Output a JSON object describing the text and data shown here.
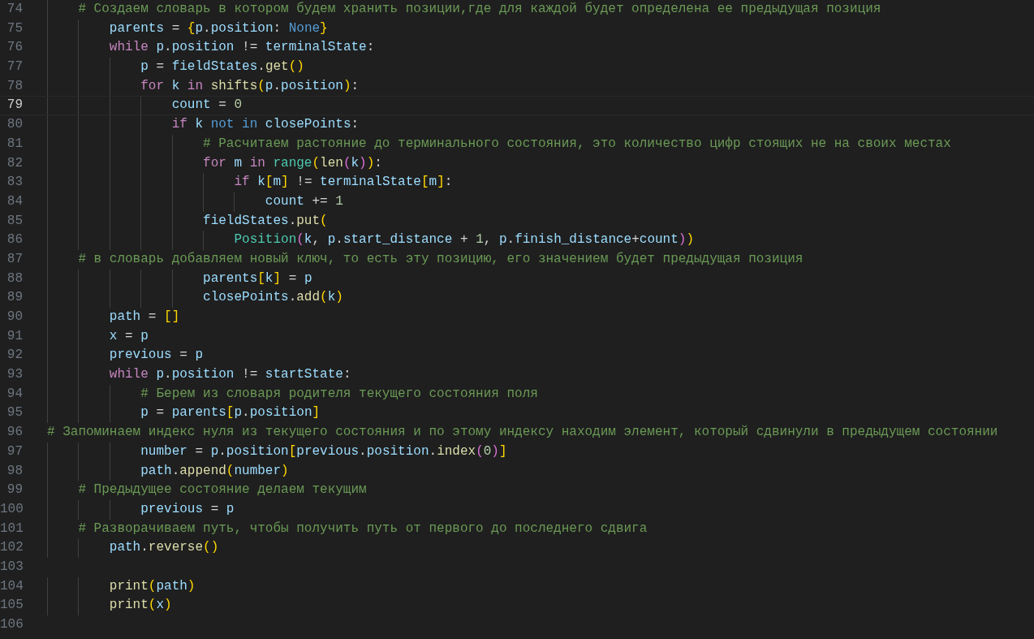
{
  "editor": {
    "lines": [
      {
        "number": "74",
        "current": false,
        "tokens": [
          {
            "kind": "cmt",
            "text": "    # Создаем словарь в котором будем хранить позиции,где для каждой будет определена ее предыдущая позиция"
          }
        ]
      },
      {
        "number": "75",
        "current": false,
        "tokens": [
          {
            "kind": "var",
            "text": "        parents"
          },
          {
            "kind": "op",
            "text": " = "
          },
          {
            "kind": "b1",
            "text": "{"
          },
          {
            "kind": "var",
            "text": "p"
          },
          {
            "kind": "op",
            "text": "."
          },
          {
            "kind": "var",
            "text": "position"
          },
          {
            "kind": "op",
            "text": ": "
          },
          {
            "kind": "const",
            "text": "None"
          },
          {
            "kind": "b1",
            "text": "}"
          }
        ]
      },
      {
        "number": "76",
        "current": false,
        "tokens": [
          {
            "kind": "kw",
            "text": "        while "
          },
          {
            "kind": "var",
            "text": "p"
          },
          {
            "kind": "op",
            "text": "."
          },
          {
            "kind": "var",
            "text": "position"
          },
          {
            "kind": "op",
            "text": " != "
          },
          {
            "kind": "var",
            "text": "terminalState"
          },
          {
            "kind": "op",
            "text": ":"
          }
        ]
      },
      {
        "number": "77",
        "current": false,
        "tokens": [
          {
            "kind": "var",
            "text": "            p"
          },
          {
            "kind": "op",
            "text": " = "
          },
          {
            "kind": "var",
            "text": "fieldStates"
          },
          {
            "kind": "op",
            "text": "."
          },
          {
            "kind": "fn",
            "text": "get"
          },
          {
            "kind": "b1",
            "text": "()"
          }
        ]
      },
      {
        "number": "78",
        "current": false,
        "tokens": [
          {
            "kind": "kw",
            "text": "            for "
          },
          {
            "kind": "var",
            "text": "k "
          },
          {
            "kind": "kw",
            "text": "in "
          },
          {
            "kind": "fn",
            "text": "shifts"
          },
          {
            "kind": "b1",
            "text": "("
          },
          {
            "kind": "var",
            "text": "p"
          },
          {
            "kind": "op",
            "text": "."
          },
          {
            "kind": "var",
            "text": "position"
          },
          {
            "kind": "b1",
            "text": ")"
          },
          {
            "kind": "op",
            "text": ":"
          }
        ]
      },
      {
        "number": "79",
        "current": true,
        "tokens": [
          {
            "kind": "var",
            "text": "                count"
          },
          {
            "kind": "op",
            "text": " = "
          },
          {
            "kind": "num",
            "text": "0"
          }
        ]
      },
      {
        "number": "80",
        "current": false,
        "tokens": [
          {
            "kind": "kw",
            "text": "                if "
          },
          {
            "kind": "var",
            "text": "k "
          },
          {
            "kind": "const",
            "text": "not in "
          },
          {
            "kind": "var",
            "text": "closePoints"
          },
          {
            "kind": "op",
            "text": ":"
          }
        ]
      },
      {
        "number": "81",
        "current": false,
        "tokens": [
          {
            "kind": "cmt",
            "text": "                    # Расчитаем растояние до терминального состояния, это количество цифр стоящих не на своих местах"
          }
        ]
      },
      {
        "number": "82",
        "current": false,
        "tokens": [
          {
            "kind": "kw",
            "text": "                    for "
          },
          {
            "kind": "var",
            "text": "m "
          },
          {
            "kind": "kw",
            "text": "in "
          },
          {
            "kind": "cls",
            "text": "range"
          },
          {
            "kind": "b1",
            "text": "("
          },
          {
            "kind": "fn",
            "text": "len"
          },
          {
            "kind": "b2",
            "text": "("
          },
          {
            "kind": "var",
            "text": "k"
          },
          {
            "kind": "b2",
            "text": ")"
          },
          {
            "kind": "b1",
            "text": ")"
          },
          {
            "kind": "op",
            "text": ":"
          }
        ]
      },
      {
        "number": "83",
        "current": false,
        "tokens": [
          {
            "kind": "kw",
            "text": "                        if "
          },
          {
            "kind": "var",
            "text": "k"
          },
          {
            "kind": "b1",
            "text": "["
          },
          {
            "kind": "var",
            "text": "m"
          },
          {
            "kind": "b1",
            "text": "]"
          },
          {
            "kind": "op",
            "text": " != "
          },
          {
            "kind": "var",
            "text": "terminalState"
          },
          {
            "kind": "b1",
            "text": "["
          },
          {
            "kind": "var",
            "text": "m"
          },
          {
            "kind": "b1",
            "text": "]"
          },
          {
            "kind": "op",
            "text": ":"
          }
        ]
      },
      {
        "number": "84",
        "current": false,
        "tokens": [
          {
            "kind": "var",
            "text": "                            count"
          },
          {
            "kind": "op",
            "text": " += "
          },
          {
            "kind": "num",
            "text": "1"
          }
        ]
      },
      {
        "number": "85",
        "current": false,
        "tokens": [
          {
            "kind": "var",
            "text": "                    fieldStates"
          },
          {
            "kind": "op",
            "text": "."
          },
          {
            "kind": "fn",
            "text": "put"
          },
          {
            "kind": "b1",
            "text": "("
          }
        ]
      },
      {
        "number": "86",
        "current": false,
        "tokens": [
          {
            "kind": "cls",
            "text": "                        Position"
          },
          {
            "kind": "b2",
            "text": "("
          },
          {
            "kind": "var",
            "text": "k"
          },
          {
            "kind": "op",
            "text": ", "
          },
          {
            "kind": "var",
            "text": "p"
          },
          {
            "kind": "op",
            "text": "."
          },
          {
            "kind": "var",
            "text": "start_distance"
          },
          {
            "kind": "op",
            "text": " + "
          },
          {
            "kind": "num",
            "text": "1"
          },
          {
            "kind": "op",
            "text": ", "
          },
          {
            "kind": "var",
            "text": "p"
          },
          {
            "kind": "op",
            "text": "."
          },
          {
            "kind": "var",
            "text": "finish_distance"
          },
          {
            "kind": "op",
            "text": "+"
          },
          {
            "kind": "var",
            "text": "count"
          },
          {
            "kind": "b2",
            "text": ")"
          },
          {
            "kind": "b1",
            "text": ")"
          }
        ]
      },
      {
        "number": "87",
        "current": false,
        "tokens": [
          {
            "kind": "cmt",
            "text": "    # в словарь добавляем новый ключ, то есть эту позицию, его значением будет предыдущая позиция"
          }
        ]
      },
      {
        "number": "88",
        "current": false,
        "tokens": [
          {
            "kind": "var",
            "text": "                    parents"
          },
          {
            "kind": "b1",
            "text": "["
          },
          {
            "kind": "var",
            "text": "k"
          },
          {
            "kind": "b1",
            "text": "]"
          },
          {
            "kind": "op",
            "text": " = "
          },
          {
            "kind": "var",
            "text": "p"
          }
        ]
      },
      {
        "number": "89",
        "current": false,
        "tokens": [
          {
            "kind": "var",
            "text": "                    closePoints"
          },
          {
            "kind": "op",
            "text": "."
          },
          {
            "kind": "fn",
            "text": "add"
          },
          {
            "kind": "b1",
            "text": "("
          },
          {
            "kind": "var",
            "text": "k"
          },
          {
            "kind": "b1",
            "text": ")"
          }
        ]
      },
      {
        "number": "90",
        "current": false,
        "tokens": [
          {
            "kind": "var",
            "text": "        path"
          },
          {
            "kind": "op",
            "text": " = "
          },
          {
            "kind": "b1",
            "text": "[]"
          }
        ]
      },
      {
        "number": "91",
        "current": false,
        "tokens": [
          {
            "kind": "var",
            "text": "        x"
          },
          {
            "kind": "op",
            "text": " = "
          },
          {
            "kind": "var",
            "text": "p"
          }
        ]
      },
      {
        "number": "92",
        "current": false,
        "tokens": [
          {
            "kind": "var",
            "text": "        previous"
          },
          {
            "kind": "op",
            "text": " = "
          },
          {
            "kind": "var",
            "text": "p"
          }
        ]
      },
      {
        "number": "93",
        "current": false,
        "tokens": [
          {
            "kind": "kw",
            "text": "        while "
          },
          {
            "kind": "var",
            "text": "p"
          },
          {
            "kind": "op",
            "text": "."
          },
          {
            "kind": "var",
            "text": "position"
          },
          {
            "kind": "op",
            "text": " != "
          },
          {
            "kind": "var",
            "text": "startState"
          },
          {
            "kind": "op",
            "text": ":"
          }
        ]
      },
      {
        "number": "94",
        "current": false,
        "tokens": [
          {
            "kind": "cmt",
            "text": "            # Берем из словаря родителя текущего состояния поля"
          }
        ]
      },
      {
        "number": "95",
        "current": false,
        "tokens": [
          {
            "kind": "var",
            "text": "            p"
          },
          {
            "kind": "op",
            "text": " = "
          },
          {
            "kind": "var",
            "text": "parents"
          },
          {
            "kind": "b1",
            "text": "["
          },
          {
            "kind": "var",
            "text": "p"
          },
          {
            "kind": "op",
            "text": "."
          },
          {
            "kind": "var",
            "text": "position"
          },
          {
            "kind": "b1",
            "text": "]"
          }
        ]
      },
      {
        "number": "96",
        "current": false,
        "tokens": [
          {
            "kind": "cmt",
            "text": "# Запоминаем индекс нуля из текущего состояния и по этому индексу находим элемент, который сдвинули в предыдущем состоянии"
          }
        ]
      },
      {
        "number": "97",
        "current": false,
        "tokens": [
          {
            "kind": "var",
            "text": "            number"
          },
          {
            "kind": "op",
            "text": " = "
          },
          {
            "kind": "var",
            "text": "p"
          },
          {
            "kind": "op",
            "text": "."
          },
          {
            "kind": "var",
            "text": "position"
          },
          {
            "kind": "b1",
            "text": "["
          },
          {
            "kind": "var",
            "text": "previous"
          },
          {
            "kind": "op",
            "text": "."
          },
          {
            "kind": "var",
            "text": "position"
          },
          {
            "kind": "op",
            "text": "."
          },
          {
            "kind": "fn",
            "text": "index"
          },
          {
            "kind": "b2",
            "text": "("
          },
          {
            "kind": "num",
            "text": "0"
          },
          {
            "kind": "b2",
            "text": ")"
          },
          {
            "kind": "b1",
            "text": "]"
          }
        ]
      },
      {
        "number": "98",
        "current": false,
        "tokens": [
          {
            "kind": "var",
            "text": "            path"
          },
          {
            "kind": "op",
            "text": "."
          },
          {
            "kind": "fn",
            "text": "append"
          },
          {
            "kind": "b1",
            "text": "("
          },
          {
            "kind": "var",
            "text": "number"
          },
          {
            "kind": "b1",
            "text": ")"
          }
        ]
      },
      {
        "number": "99",
        "current": false,
        "tokens": [
          {
            "kind": "cmt",
            "text": "    # Предыдущее состояние делаем текущим"
          }
        ]
      },
      {
        "number": "100",
        "current": false,
        "tokens": [
          {
            "kind": "var",
            "text": "            previous"
          },
          {
            "kind": "op",
            "text": " = "
          },
          {
            "kind": "var",
            "text": "p"
          }
        ]
      },
      {
        "number": "101",
        "current": false,
        "tokens": [
          {
            "kind": "cmt",
            "text": "    # Разворачиваем путь, чтобы получить путь от первого до последнего сдвига"
          }
        ]
      },
      {
        "number": "102",
        "current": false,
        "tokens": [
          {
            "kind": "var",
            "text": "        path"
          },
          {
            "kind": "op",
            "text": "."
          },
          {
            "kind": "fn",
            "text": "reverse"
          },
          {
            "kind": "b1",
            "text": "()"
          }
        ]
      },
      {
        "number": "103",
        "current": false
      },
      {
        "number": "104",
        "current": false,
        "tokens": [
          {
            "kind": "fn",
            "text": "        print"
          },
          {
            "kind": "b1",
            "text": "("
          },
          {
            "kind": "var",
            "text": "path"
          },
          {
            "kind": "b1",
            "text": ")"
          }
        ]
      },
      {
        "number": "105",
        "current": false,
        "tokens": [
          {
            "kind": "fn",
            "text": "        print"
          },
          {
            "kind": "b1",
            "text": "("
          },
          {
            "kind": "var",
            "text": "x"
          },
          {
            "kind": "b1",
            "text": ")"
          }
        ]
      },
      {
        "number": "106",
        "current": false
      }
    ]
  }
}
